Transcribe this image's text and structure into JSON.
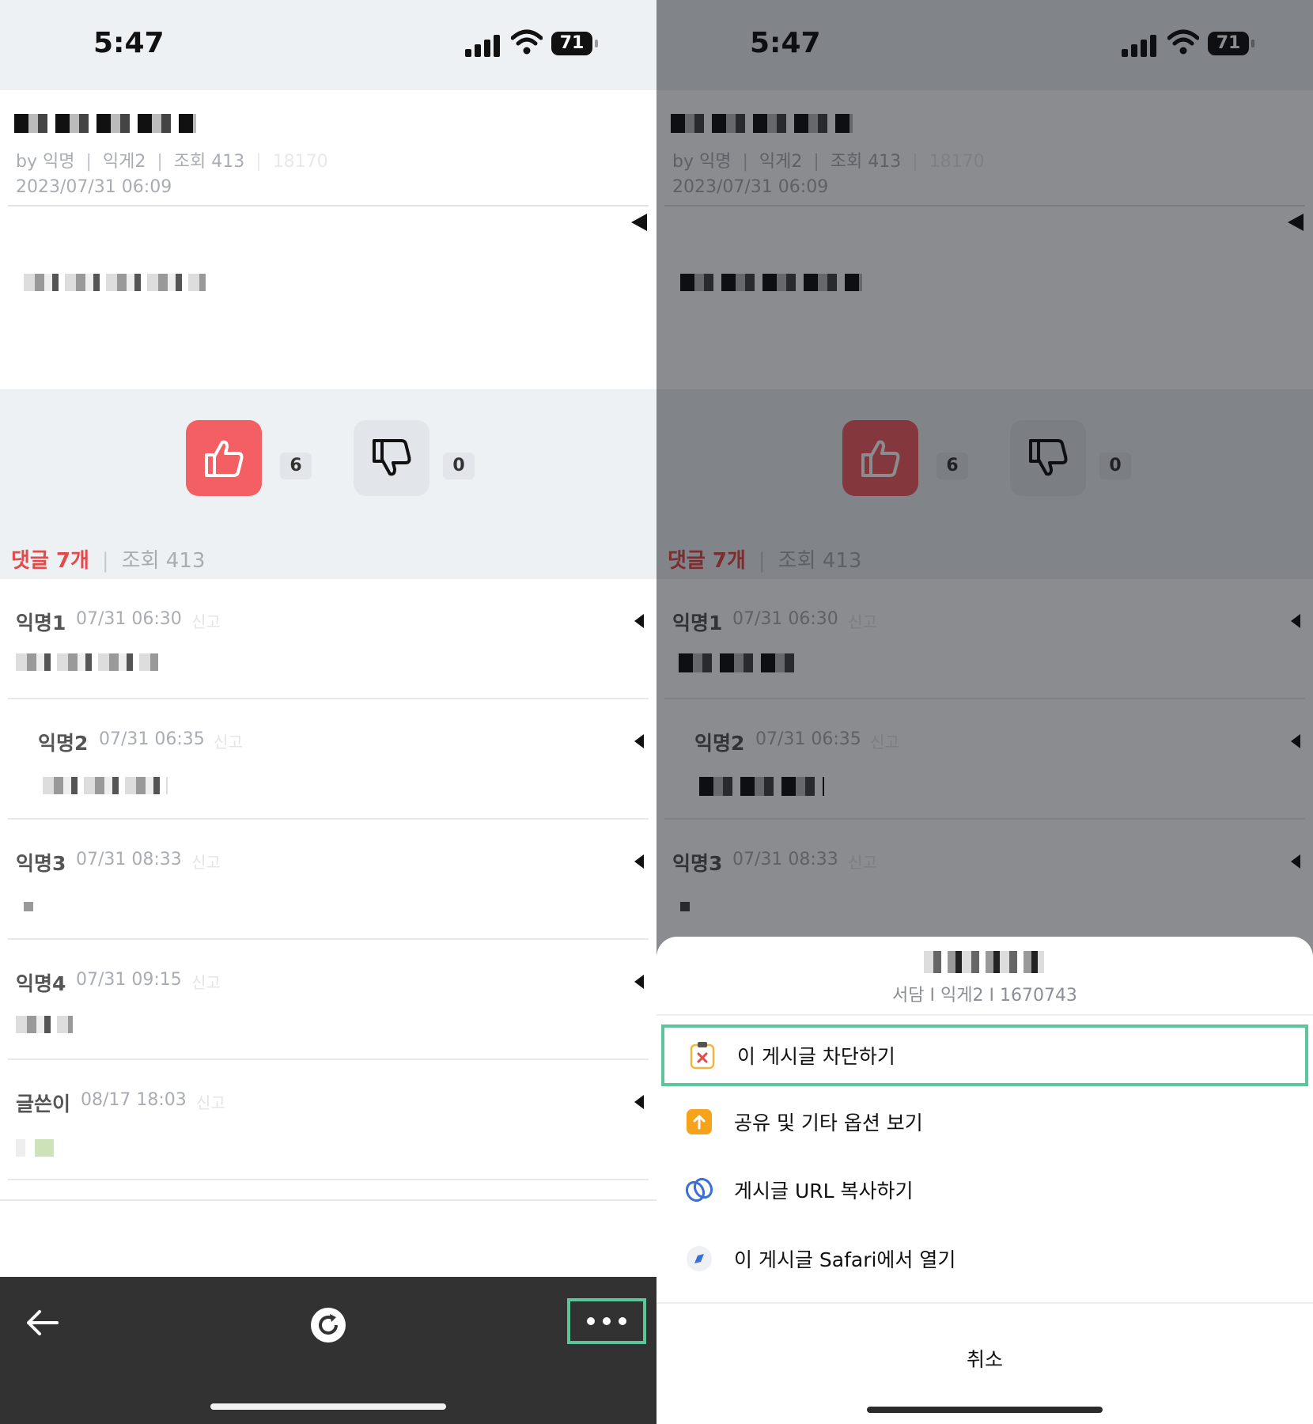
{
  "status_bar": {
    "time": "5:47",
    "battery": "71"
  },
  "post": {
    "meta": {
      "by": "by 익명",
      "board": "익게2",
      "views": "조회 413",
      "faint_id": "18170"
    },
    "date": "2023/07/31 06:09"
  },
  "votes": {
    "up_count": "6",
    "down_count": "0"
  },
  "comments_header": {
    "count_label": "댓글 7개",
    "separator": "|",
    "views": "조회 413"
  },
  "comments": [
    {
      "author": "익명1",
      "time": "07/31 06:30",
      "report": "신고"
    },
    {
      "author": "익명2",
      "time": "07/31 06:35",
      "report": "신고"
    },
    {
      "author": "익명3",
      "time": "07/31 08:33",
      "report": "신고"
    },
    {
      "author": "익명4",
      "time": "07/31 09:15",
      "report": "신고"
    },
    {
      "author": "글쓴이",
      "time": "08/17 18:03",
      "report": "신고"
    }
  ],
  "action_sheet": {
    "subtitle": "서담 I 익게2 I 1670743",
    "items": [
      {
        "label": "이 게시글 차단하기",
        "icon": "block-post-icon"
      },
      {
        "label": "공유 및 기타 옵션 보기",
        "icon": "share-icon"
      },
      {
        "label": "게시글 URL 복사하기",
        "icon": "link-icon"
      },
      {
        "label": "이 게시글 Safari에서 열기",
        "icon": "safari-icon"
      }
    ],
    "cancel": "취소"
  },
  "colors": {
    "accent_red": "#f35f62",
    "highlight_green": "#5cc59a",
    "bottom_bar": "#323232"
  }
}
